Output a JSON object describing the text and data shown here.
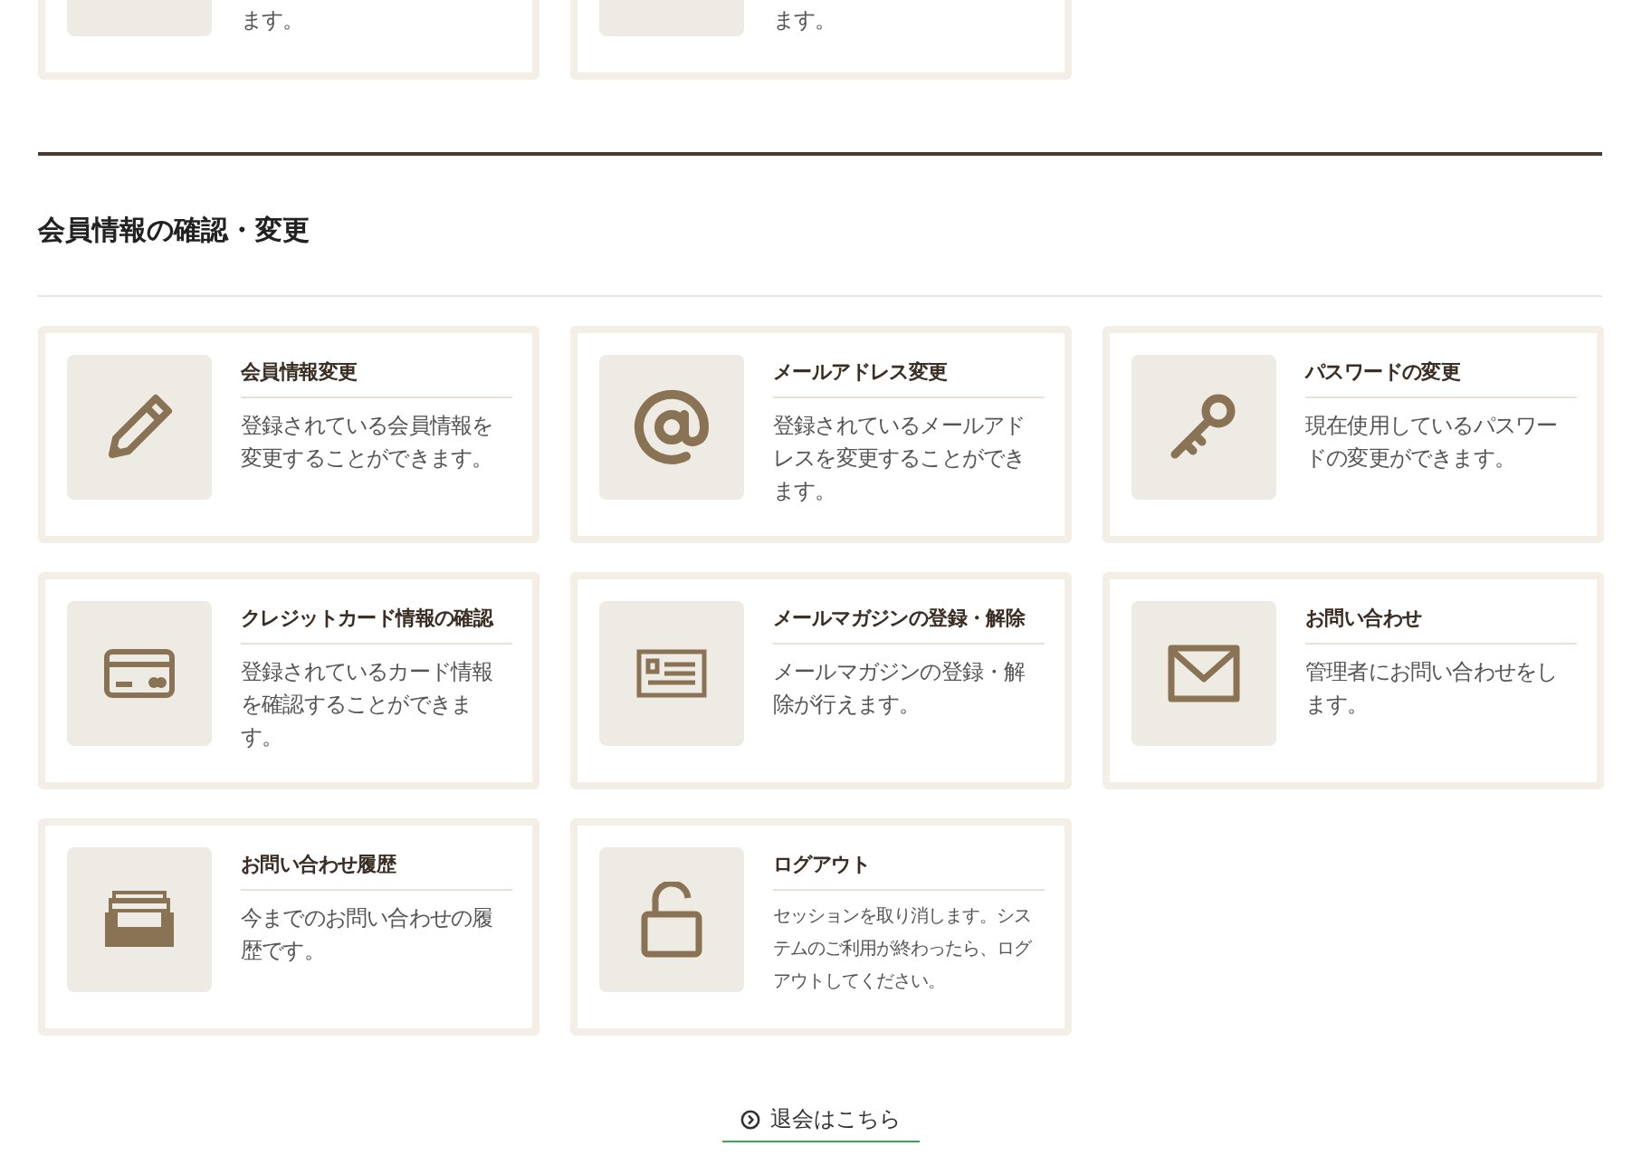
{
  "previous_cards": [
    {
      "description": "ます。"
    },
    {
      "description": "ます。"
    }
  ],
  "section": {
    "title": "会員情報の確認・変更"
  },
  "cards": [
    {
      "kind": "pencil",
      "title": "会員情報変更",
      "description": "登録されている会員情報を変更することができます。"
    },
    {
      "kind": "at",
      "title": "メールアドレス変更",
      "description": "登録されているメールアドレスを変更することができます。"
    },
    {
      "kind": "key",
      "title": "パスワードの変更",
      "description": "現在使用しているパスワードの変更ができます。"
    },
    {
      "kind": "card",
      "title": "クレジットカード情報の確認",
      "description": "登録されているカード情報を確認することができます。"
    },
    {
      "kind": "newsletter",
      "title": "メールマガジンの登録・解除",
      "description": "メールマガジンの登録・解除が行えます。"
    },
    {
      "kind": "mail",
      "title": "お問い合わせ",
      "description": "管理者にお問い合わせをします。"
    },
    {
      "kind": "tray",
      "title": "お問い合わせ履歴",
      "description": "今までのお問い合わせの履歴です。"
    },
    {
      "kind": "lock",
      "title": "ログアウト",
      "description": "セッションを取り消します。システムのご利用が終わったら、ログアウトしてください。",
      "small": true
    }
  ],
  "withdraw_link": {
    "label": "退会はこちら"
  }
}
